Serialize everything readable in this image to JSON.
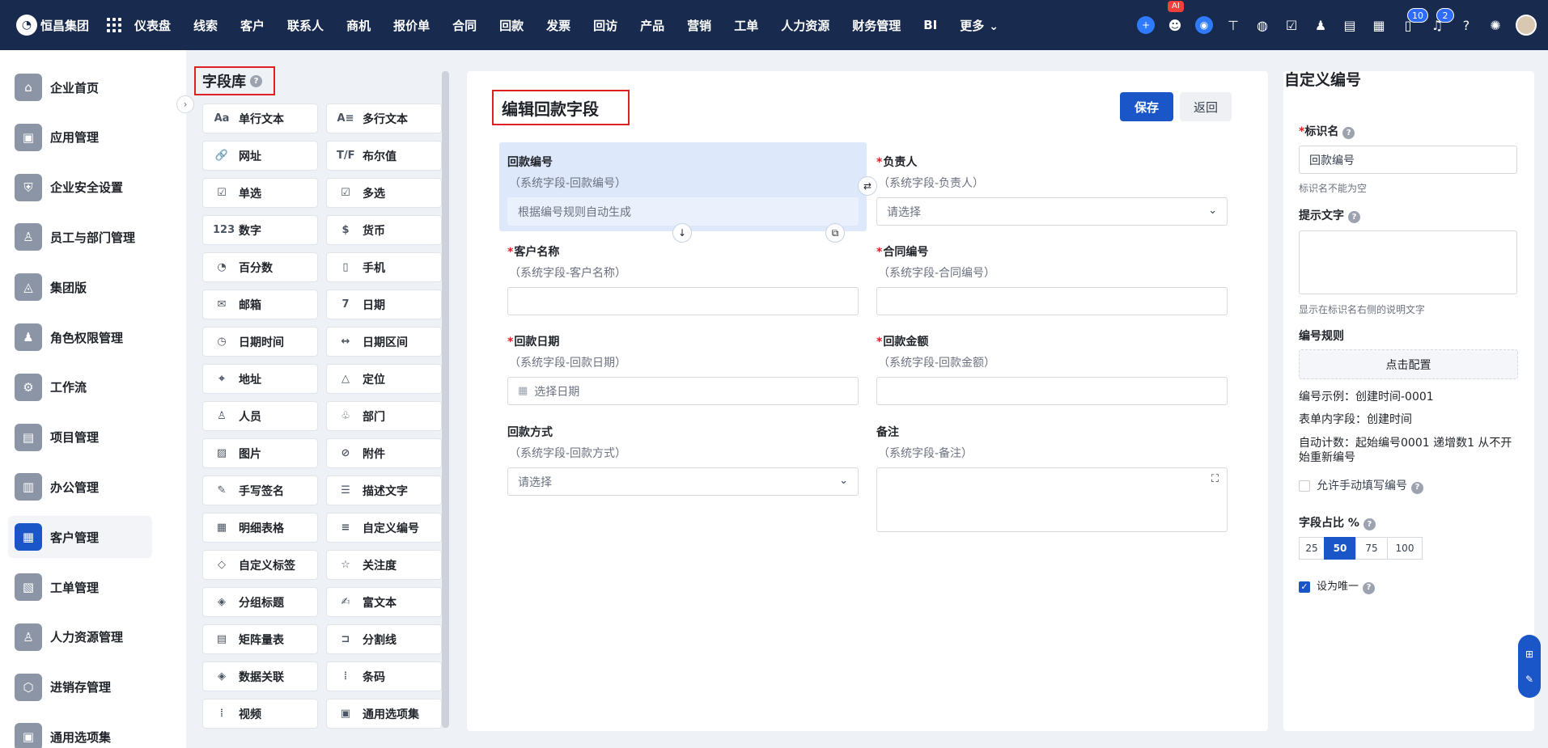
{
  "topbar": {
    "brand": "恒昌集团",
    "nav": [
      "仪表盘",
      "线索",
      "客户",
      "联系人",
      "商机",
      "报价单",
      "合同",
      "回款",
      "发票",
      "回访",
      "产品",
      "营销",
      "工单",
      "人力资源",
      "财务管理",
      "BI",
      "更多"
    ],
    "ai_badge": "AI",
    "notice_count": "10",
    "bell_count": "2"
  },
  "sidebar": {
    "items": [
      "企业首页",
      "应用管理",
      "企业安全设置",
      "员工与部门管理",
      "集团版",
      "角色权限管理",
      "工作流",
      "项目管理",
      "办公管理",
      "客户管理",
      "工单管理",
      "人力资源管理",
      "进销存管理",
      "通用选项集"
    ],
    "active_index": 9
  },
  "library": {
    "title": "字段库",
    "items": [
      {
        "label": "单行文本",
        "icon": "Aa"
      },
      {
        "label": "多行文本",
        "icon": "A≡"
      },
      {
        "label": "网址",
        "icon": "🔗"
      },
      {
        "label": "布尔值",
        "icon": "T/F"
      },
      {
        "label": "单选",
        "icon": "☑"
      },
      {
        "label": "多选",
        "icon": "☑"
      },
      {
        "label": "数字",
        "icon": "123"
      },
      {
        "label": "货币",
        "icon": "$"
      },
      {
        "label": "百分数",
        "icon": "◔"
      },
      {
        "label": "手机",
        "icon": "▯"
      },
      {
        "label": "邮箱",
        "icon": "✉"
      },
      {
        "label": "日期",
        "icon": "7"
      },
      {
        "label": "日期时间",
        "icon": "◷"
      },
      {
        "label": "日期区间",
        "icon": "↔"
      },
      {
        "label": "地址",
        "icon": "⌖"
      },
      {
        "label": "定位",
        "icon": "△"
      },
      {
        "label": "人员",
        "icon": "♙"
      },
      {
        "label": "部门",
        "icon": "♧"
      },
      {
        "label": "图片",
        "icon": "▨"
      },
      {
        "label": "附件",
        "icon": "⊘"
      },
      {
        "label": "手写签名",
        "icon": "✎"
      },
      {
        "label": "描述文字",
        "icon": "☰"
      },
      {
        "label": "明细表格",
        "icon": "▦"
      },
      {
        "label": "自定义编号",
        "icon": "≡"
      },
      {
        "label": "自定义标签",
        "icon": "◇"
      },
      {
        "label": "关注度",
        "icon": "☆"
      },
      {
        "label": "分组标题",
        "icon": "◈"
      },
      {
        "label": "富文本",
        "icon": "✍"
      },
      {
        "label": "矩阵量表",
        "icon": "▤"
      },
      {
        "label": "分割线",
        "icon": "⊐"
      },
      {
        "label": "数据关联",
        "icon": "◈"
      },
      {
        "label": "条码",
        "icon": "⦙"
      },
      {
        "label": "视频",
        "icon": "⦙"
      },
      {
        "label": "通用选项集",
        "icon": "▣"
      }
    ]
  },
  "form": {
    "title": "编辑回款字段",
    "save": "保存",
    "back": "返回",
    "fields": {
      "code": {
        "label": "回款编号",
        "sub": "（系统字段-回款编号）",
        "placeholder": "根据编号规则自动生成"
      },
      "owner": {
        "label": "负责人",
        "sub": "（系统字段-负责人）",
        "placeholder": "请选择"
      },
      "customer": {
        "label": "客户名称",
        "sub": "（系统字段-客户名称）"
      },
      "contract": {
        "label": "合同编号",
        "sub": "（系统字段-合同编号）"
      },
      "date": {
        "label": "回款日期",
        "sub": "（系统字段-回款日期）",
        "placeholder": "选择日期"
      },
      "amount": {
        "label": "回款金额",
        "sub": "（系统字段-回款金额）"
      },
      "method": {
        "label": "回款方式",
        "sub": "（系统字段-回款方式）",
        "placeholder": "请选择"
      },
      "remark": {
        "label": "备注",
        "sub": "（系统字段-备注）"
      }
    }
  },
  "panel": {
    "title": "自定义编号",
    "id_label": "标识名",
    "id_value": "回款编号",
    "id_hint": "标识名不能为空",
    "tip_label": "提示文字",
    "tip_hint": "显示在标识名右侧的说明文字",
    "rule_label": "编号规则",
    "rule_btn": "点击配置",
    "example": "编号示例：创建时间-0001",
    "inner_field": "表单内字段：创建时间",
    "auto_count": "自动计数：起始编号0001 递增数1 从不开始重新编号",
    "allow_manual": "允许手动填写编号",
    "ratio_label": "字段占比 %",
    "ratios": [
      "25",
      "50",
      "75",
      "100"
    ],
    "ratio_selected": "50",
    "unique": "设为唯一"
  }
}
